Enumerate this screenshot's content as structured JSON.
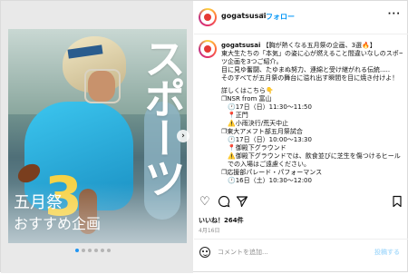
{
  "media": {
    "title": "スポーツ",
    "subtitle_line1": "五月祭",
    "subtitle_line2": "おすすめ企画",
    "next_arrow": "›",
    "slide_count": 6,
    "active_slide": 0,
    "jersey_number": "3"
  },
  "header": {
    "username": "gogatsusai",
    "separator": "•",
    "follow_label": "フォロー",
    "more_label": "···"
  },
  "caption": {
    "username": "gogatsusai",
    "lines": [
      "【胸が熱くなる五月祭の企画、3選🔥】",
      "東大生たちの「本気」の姿に心が燃えること間違いなしのスポー",
      "ツ企画を3つご紹介。",
      "目に見ゆ奮闘、たゆまぬ努力、連綿と受け継がれる伝統.....",
      "そのすべてが五月祭の舞台に溢れ出す瞬間を目に焼き付けよ！",
      "",
      "詳しくはこちら👇",
      "❐NSR from 富山",
      "　🕐17日（日）11:30〜11:50",
      "　📍正門",
      "　⚠️小雨決行/荒天中止",
      "❐東大アメフト部五月祭試合",
      "　🕐17日（日）10:00〜13:30",
      "　📍御殿下グラウンド",
      "　⚠️御殿下グラウンドでは、飲食並びに芝生を傷つけるヒール",
      "　での入場はご遠慮ください。",
      "❐応援部パレード・パフォーマンス",
      "　🕐16日（土）10:30〜12:00"
    ]
  },
  "actions": {
    "like_icon": "heart-icon",
    "comment_icon": "comment-icon",
    "share_icon": "share-icon",
    "save_icon": "bookmark-icon"
  },
  "likes_text": "いいね！264件",
  "date_text": "4月16日",
  "comment": {
    "placeholder": "コメントを追加...",
    "post_label": "投稿する"
  },
  "colors": {
    "follow": "#0095f6",
    "post_disabled": "#b2dffc",
    "active_dot": "#2196f3"
  }
}
